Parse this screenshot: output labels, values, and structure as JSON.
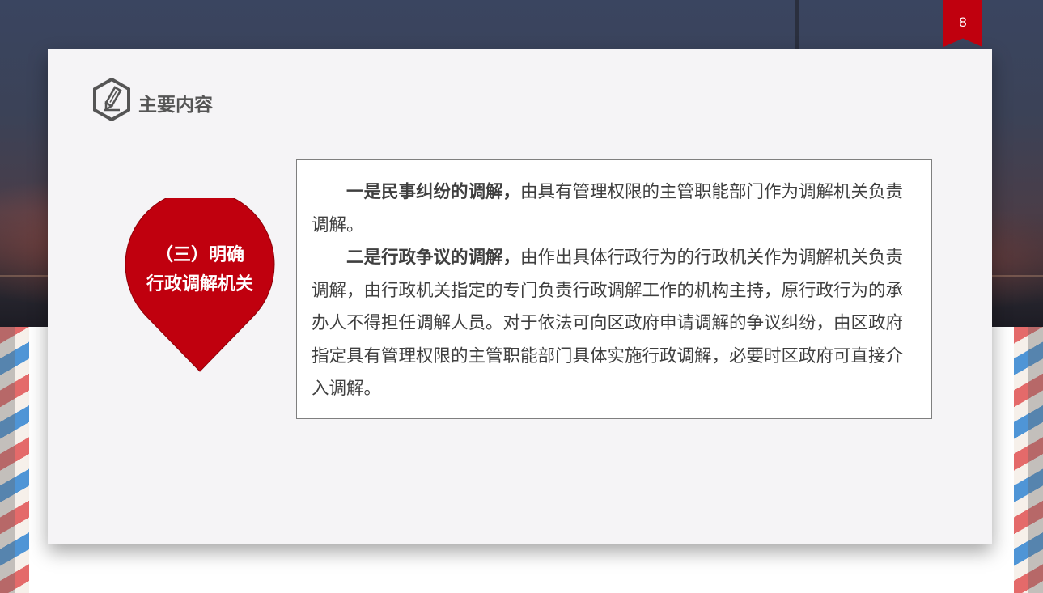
{
  "page_number": "8",
  "header": {
    "icon": "hexagon-pencil-icon",
    "title": "主要内容"
  },
  "pin": {
    "line1": "（三）明确",
    "line2": "行政调解机关",
    "color": "#c0000e"
  },
  "content": {
    "p1_bold": "一是民事纠纷的调解，",
    "p1_text": "由具有管理权限的主管职能部门作为调解机关负责调解。",
    "p2_bold": "二是行政争议的调解，",
    "p2_text": "由作出具体行政行为的行政机关作为调解机关负责调解，由行政机关指定的专门负责行政调解工作的机构主持，原行政行为的承办人不得担任调解人员。对于依法可向区政府申请调解的争议纠纷，由区政府指定具有管理权限的主管职能部门具体实施行政调解，必要时区政府可直接介入调解。"
  },
  "colors": {
    "accent": "#c0000e",
    "card": "#f5f4f6",
    "text": "#3f3f3f"
  }
}
